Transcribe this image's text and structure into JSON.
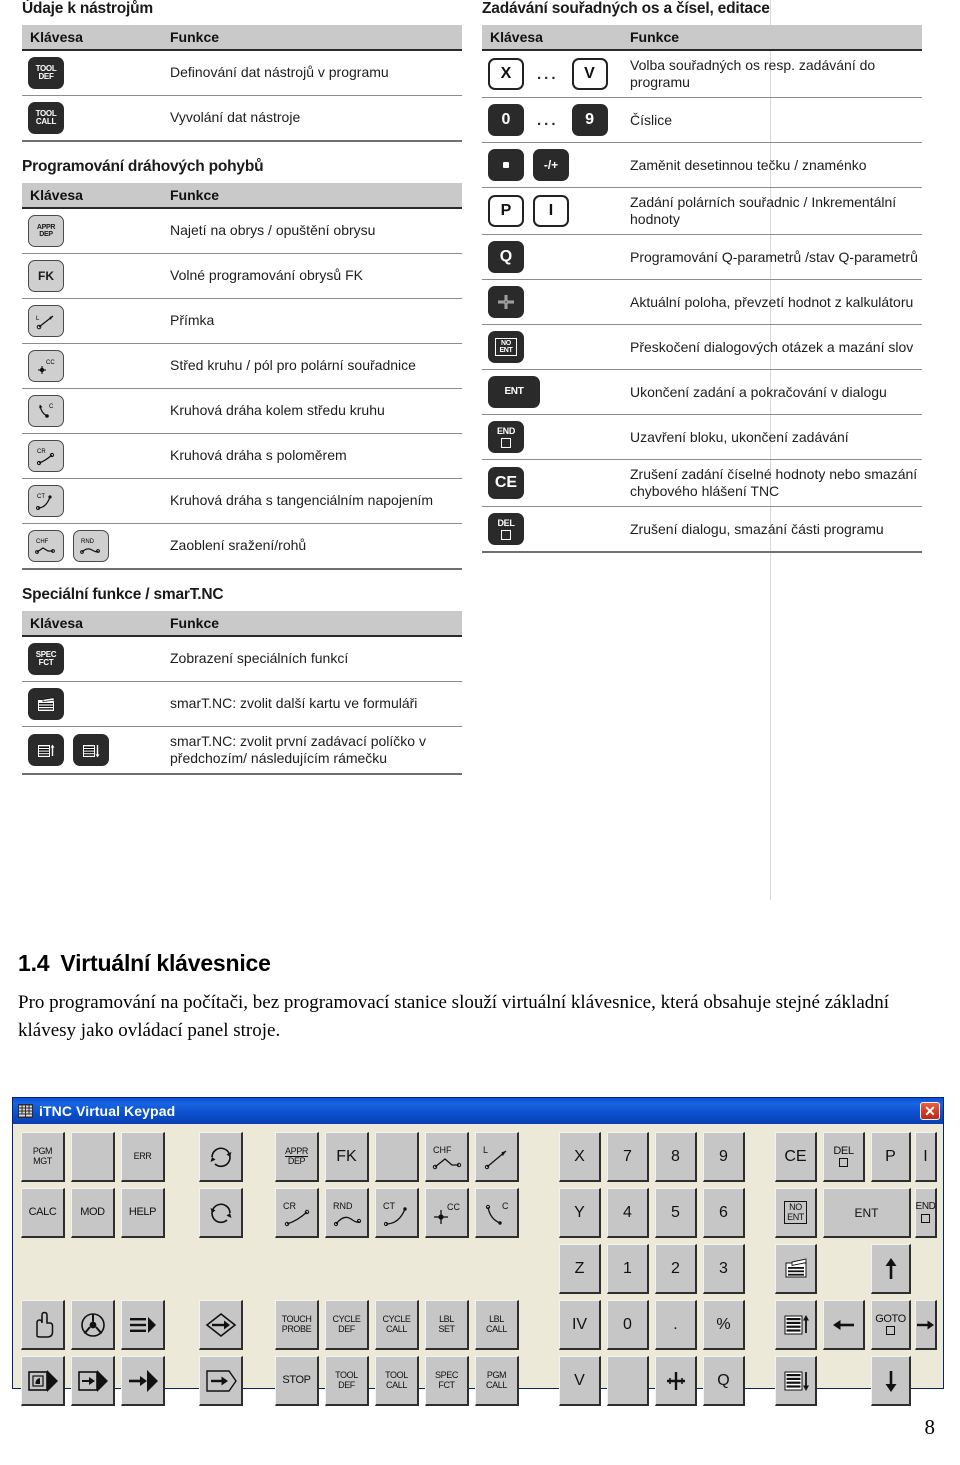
{
  "reference": {
    "columns": {
      "left": [
        {
          "id": "tool-data",
          "title": "Údaje k nástrojům",
          "headers": {
            "key": "Klávesa",
            "function": "Funkce"
          },
          "rows": [
            {
              "keys": [
                {
                  "style": "dark",
                  "l1": "TOOL",
                  "l2": "DEF"
                }
              ],
              "function": "Definování dat nástrojů v programu"
            },
            {
              "keys": [
                {
                  "style": "dark",
                  "l1": "TOOL",
                  "l2": "CALL"
                }
              ],
              "function": "Vyvolání dat nástroje"
            }
          ]
        },
        {
          "id": "path-motion",
          "title": "Programování dráhových pohybů",
          "headers": {
            "key": "Klávesa",
            "function": "Funkce"
          },
          "rows": [
            {
              "keys": [
                {
                  "style": "light",
                  "l1": "APPR",
                  "l2": "DEP",
                  "rule": true
                }
              ],
              "function": "Najetí na obrys / opuštění obrysu"
            },
            {
              "keys": [
                {
                  "style": "light",
                  "big": "FK"
                }
              ],
              "function": "Volné programování obrysů FK"
            },
            {
              "keys": [
                {
                  "style": "light",
                  "icon": "line-L"
                }
              ],
              "function": "Přímka"
            },
            {
              "keys": [
                {
                  "style": "light",
                  "icon": "circle-center-CC"
                }
              ],
              "function": "Střed kruhu / pól pro polární souřadnice"
            },
            {
              "keys": [
                {
                  "style": "light",
                  "icon": "arc-C"
                }
              ],
              "function": "Kruhová dráha kolem středu kruhu"
            },
            {
              "keys": [
                {
                  "style": "light",
                  "icon": "arc-CR"
                }
              ],
              "function": "Kruhová dráha s poloměrem"
            },
            {
              "keys": [
                {
                  "style": "light",
                  "icon": "arc-CT"
                }
              ],
              "function": "Kruhová dráha s tangenciálním napojením"
            },
            {
              "keys": [
                {
                  "style": "light",
                  "icon": "chamfer-CHF"
                },
                {
                  "style": "light",
                  "icon": "round-RND"
                }
              ],
              "function": "Zaoblení sražení/rohů"
            }
          ]
        },
        {
          "id": "special-smartnc",
          "title": "Speciální funkce / smarT.NC",
          "headers": {
            "key": "Klávesa",
            "function": "Funkce"
          },
          "rows": [
            {
              "keys": [
                {
                  "style": "dark",
                  "l1": "SPEC",
                  "l2": "FCT"
                }
              ],
              "function": "Zobrazení speciálních funkcí"
            },
            {
              "keys": [
                {
                  "style": "dark",
                  "icon": "next-tab"
                }
              ],
              "function": "smarT.NC: zvolit další kartu ve formuláři"
            },
            {
              "keys": [
                {
                  "style": "dark",
                  "icon": "form-up"
                },
                {
                  "style": "dark",
                  "icon": "form-down"
                }
              ],
              "function": "smarT.NC: zvolit první zadávací políčko v předchozím/ následujícím rámečku"
            }
          ]
        }
      ],
      "right": [
        {
          "id": "axis-number-entry",
          "title": "Zadávání souřadných os a čísel, editace",
          "headers": {
            "key": "Klávesa",
            "function": "Funkce"
          },
          "rows": [
            {
              "keys": [
                {
                  "style": "outline",
                  "big": "X"
                },
                {
                  "dots": "..."
                },
                {
                  "style": "outline",
                  "big": "V"
                }
              ],
              "function": "Volba souřadných os resp. zadávání do programu"
            },
            {
              "keys": [
                {
                  "style": "dark",
                  "big": "0"
                },
                {
                  "dots": "..."
                },
                {
                  "style": "dark",
                  "big": "9"
                }
              ],
              "function": "Číslice"
            },
            {
              "keys": [
                {
                  "style": "dark",
                  "icon": "dot"
                },
                {
                  "style": "dark",
                  "mid": "-/+"
                }
              ],
              "function": "Zaměnit desetinnou tečku / znaménko"
            },
            {
              "keys": [
                {
                  "style": "outline",
                  "big": "P"
                },
                {
                  "style": "outline",
                  "big": "I"
                }
              ],
              "function": "Zadání polárních souřadnic / Inkrementální hodnoty"
            },
            {
              "keys": [
                {
                  "style": "dark",
                  "big": "Q"
                }
              ],
              "function": "Programování Q-parametrů /stav Q-parametrů"
            },
            {
              "keys": [
                {
                  "style": "dark",
                  "icon": "actual-pos"
                }
              ],
              "function": "Aktuální poloha, převzetí hodnot z kalkulátoru"
            },
            {
              "keys": [
                {
                  "style": "dark",
                  "l1": "NO",
                  "l2": "ENT",
                  "boxed": true
                }
              ],
              "function": "Přeskočení dialogových otázek a mazání slov"
            },
            {
              "keys": [
                {
                  "style": "dark",
                  "mid": "ENT",
                  "wide": true
                }
              ],
              "function": "Ukončení zadání a pokračování v dialogu"
            },
            {
              "keys": [
                {
                  "style": "dark",
                  "l1": "END",
                  "square": true
                }
              ],
              "function": "Uzavření bloku, ukončení zadávání"
            },
            {
              "keys": [
                {
                  "style": "dark",
                  "big": "CE"
                }
              ],
              "function": "Zrušení zadání číselné hodnoty nebo smazání chybového hlášení TNC"
            },
            {
              "keys": [
                {
                  "style": "dark",
                  "l1": "DEL",
                  "square": true
                }
              ],
              "function": "Zrušení dialogu, smazání části programu"
            }
          ]
        }
      ]
    }
  },
  "article": {
    "number": "1.4",
    "heading": "Virtuální klávesnice",
    "paragraph": "Pro programování na počítači, bez programovací stanice slouží virtuální klávesnice, která obsahuje stejné základní klávesy jako ovládací panel stroje."
  },
  "keypad_window": {
    "title": "iTNC Virtual Keypad",
    "close_label": "✕",
    "keys": {
      "r1c1": {
        "l1": "PGM",
        "l2": "MGT"
      },
      "r1c3": {
        "l1": "ERR"
      },
      "r1c5_icon": "rotate-cw",
      "r1c6": {
        "l1": "APPR",
        "l2": "DEP"
      },
      "r1c7": {
        "t": "FK"
      },
      "r1c9_icon": "chamfer-CHF",
      "r1c10_icon": "line-L",
      "r1_x": "X",
      "r1_7": "7",
      "r1_8": "8",
      "r1_9": "9",
      "r1_ce": "CE",
      "r1_del": "DEL",
      "r1_p": "P",
      "r1_i": "I",
      "r2c1": {
        "l1": "CALC"
      },
      "r2c2": {
        "l1": "MOD"
      },
      "r2c3": {
        "l1": "HELP"
      },
      "r2c5_icon": "rotate-ccw",
      "r2c6_icon": "arc-CR",
      "r2c7_icon": "round-RND",
      "r2c8_icon": "arc-CT",
      "r2c9_icon": "circle-center-CC",
      "r2c10_icon": "arc-C",
      "r2_y": "Y",
      "r2_4": "4",
      "r2_5": "5",
      "r2_6": "6",
      "r2_noent_1": "NO",
      "r2_noent_2": "ENT",
      "r2_ent": "ENT",
      "r2_end": "END",
      "r3_z": "Z",
      "r3_1": "1",
      "r3_2": "2",
      "r3_3": "3",
      "r3_tab_icon": "next-tab",
      "r3_up_icon": "arrow-up",
      "r4c1_icon": "hand",
      "r4c2_icon": "handwheel",
      "r4c3_icon": "lines-arrow",
      "r4c5_icon": "diamond-arrow",
      "r4c6": {
        "l1": "TOUCH",
        "l2": "PROBE"
      },
      "r4c7": {
        "l1": "CYCLE",
        "l2": "DEF"
      },
      "r4c8": {
        "l1": "CYCLE",
        "l2": "CALL"
      },
      "r4c9": {
        "l1": "LBL",
        "l2": "SET"
      },
      "r4c10": {
        "l1": "LBL",
        "l2": "CALL"
      },
      "r4_iv": "IV",
      "r4_0": "0",
      "r4_dot": ".",
      "r4_pct": "%",
      "r4_form_icon": "form-up",
      "r4_left_icon": "arrow-left",
      "r4_goto": "GOTO",
      "r4_right_icon": "arrow-right",
      "r5c1_icon": "block-arrow-1",
      "r5c2_icon": "block-arrow-2",
      "r5c3_icon": "block-arrow-3",
      "r5c5_icon": "pent-arrow",
      "r5c6": {
        "l1": "STOP"
      },
      "r5c7": {
        "l1": "TOOL",
        "l2": "DEF"
      },
      "r5c8": {
        "l1": "TOOL",
        "l2": "CALL"
      },
      "r5c9": {
        "l1": "SPEC",
        "l2": "FCT"
      },
      "r5c10": {
        "l1": "PGM",
        "l2": "CALL"
      },
      "r5_v": "V",
      "r5_plus_icon": "actual-pos",
      "r5_q": "Q",
      "r5_form_icon": "form-down",
      "r5_down_icon": "arrow-down"
    }
  },
  "footer": {
    "page_number": "8"
  }
}
